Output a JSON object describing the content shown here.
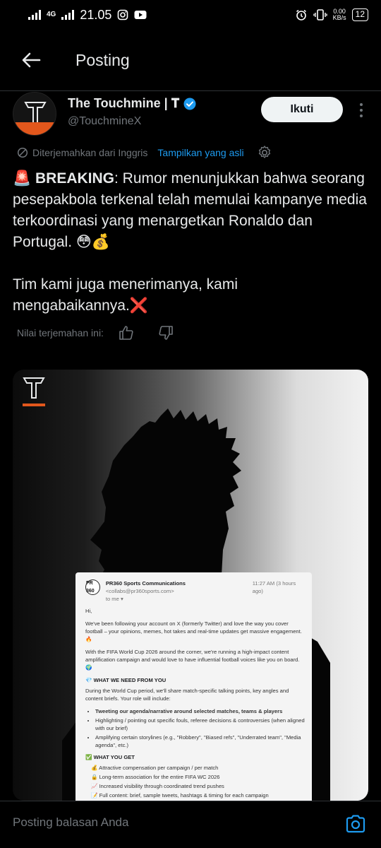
{
  "status_bar": {
    "network": "4G",
    "time": "21.05",
    "speed_value": "0.00",
    "speed_unit": "KB/s",
    "battery": "12"
  },
  "header": {
    "title": "Posting",
    "back_icon": "arrow-left-icon"
  },
  "author": {
    "name": "The Touchmine | 𝐓",
    "handle": "@TouchmineX",
    "verified_icon": "verified-badge-icon",
    "follow_label": "Ikuti",
    "more_icon": "more-vertical-icon"
  },
  "translation": {
    "translated_label": "Diterjemahkan dari Inggris",
    "show_original_label": "Tampilkan yang asli",
    "settings_icon": "gear-icon"
  },
  "tweet": {
    "siren": "🚨",
    "breaking": "BREAKING",
    "body1": ": Rumor menunjukkan bahwa seorang pesepakbola terkenal telah memulai kampanye media terkoordinasi yang menargetkan Ronaldo dan Portugal. 😳💰",
    "body2": "Tim kami juga menerimanya, kami mengabaikannya.❌"
  },
  "rating": {
    "label": "Nilai terjemahan ini:",
    "up_icon": "thumbs-up-icon",
    "down_icon": "thumbs-down-icon"
  },
  "media_email": {
    "logo_text": "PR 360",
    "sender": "PR360 Sports Communications",
    "address": "<collabs@pr360sports.com>",
    "time": "11:27 AM (3 hours ago)",
    "to": "to me ▾",
    "greeting": "Hi,",
    "para1": "We've been following your account on X (formerly Twitter) and love the way you cover football – your opinions, memes, hot takes and real-time updates get massive engagement. 🔥",
    "para2": "With the FIFA World Cup 2026 around the corner, we're running a high-impact content amplification campaign and would love to have influential football voices like you on board. 🌍",
    "section1": "💎 WHAT WE NEED FROM YOU",
    "para3": "During the World Cup period, we'll share match-specific talking points, key angles and content briefs. Your role will include:",
    "bullets": [
      "Tweeting our agenda/narrative around selected matches, teams & players",
      "Highlighting / pointing out specific fouls, referee decisions & controversies (when aligned with our brief)",
      "Amplifying certain storylines (e.g., \"Robbery\", \"Biased refs\", \"Underrated team\", \"Media agenda\", etc.)"
    ],
    "section2": "✅ WHAT YOU GET",
    "gets": [
      "💰 Attractive compensation per campaign / per match",
      "🔒 Long-term association for the entire FIFA WC 2026",
      "📈 Increased visibility through coordinated trend pushes",
      "📝 Full content: brief, sample tweets, hashtags & timing for each campaign"
    ]
  },
  "reply_bar": {
    "placeholder": "Posting balasan Anda",
    "camera_icon": "camera-icon"
  }
}
